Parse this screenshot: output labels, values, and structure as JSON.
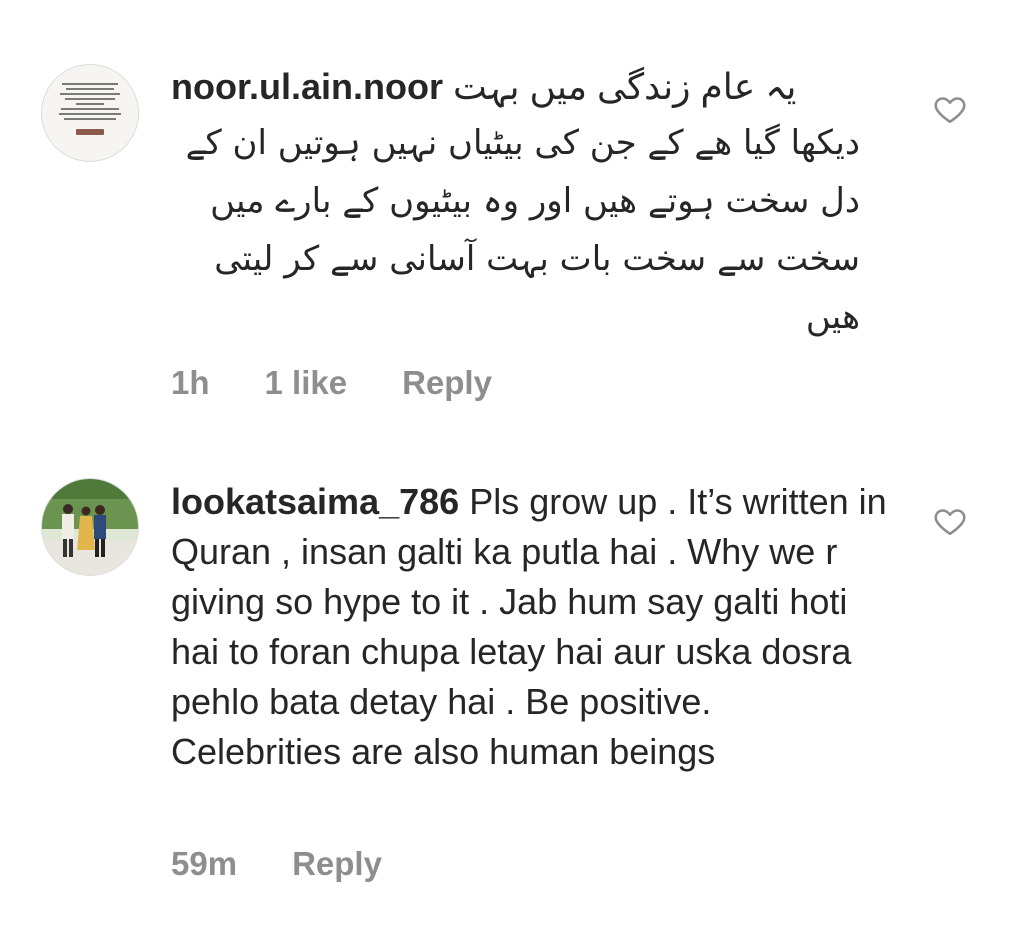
{
  "comments": [
    {
      "username": "noor.ul.ain.noor",
      "text_first_line": "یہ عام زندگی میں بہت",
      "text_rest": "دیکھا گیا ھے کے جن کی بیٹیاں نہیں ہوتیں ان کے دل سخت ہوتے ھیں اور وہ بیٹیوں کے بارے میں سخت سے سخت بات بہت آسانی سے کر لیتی ھیں",
      "time": "1h",
      "likes": "1 like",
      "reply": "Reply",
      "avatar_text": "When you don't understand what's happening in your life, just close your eyes and take a deep breath and say, \"Ya Allah, I know this is your plan, just help me through it.\""
    },
    {
      "username": "lookatsaima_786",
      "text": "Pls grow up . It’s written in Quran , insan galti ka putla hai . Why we r giving so hype to it . Jab hum say galti hoti hai to foran chupa letay hai aur uska dosra pehlo bata detay hai . Be positive. Celebrities are also human beings",
      "time": "59m",
      "reply": "Reply"
    }
  ],
  "icons": {
    "like": "heart-outline-icon"
  },
  "colors": {
    "text": "#262626",
    "meta": "#8e8e8e",
    "heart": "#8e8e8e"
  }
}
